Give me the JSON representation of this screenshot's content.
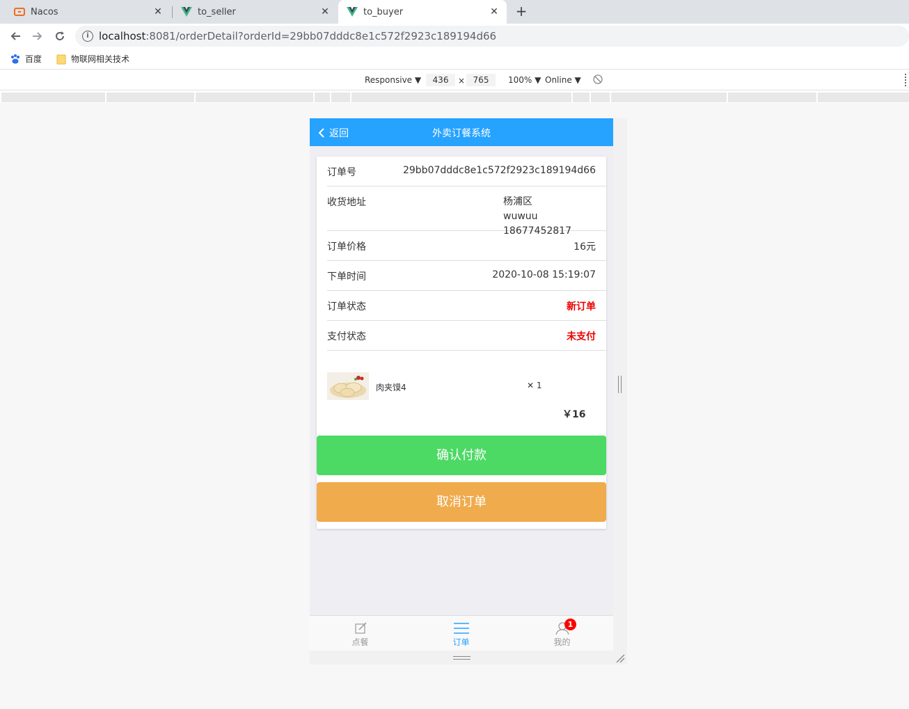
{
  "browser": {
    "tabs": [
      {
        "title": "Nacos",
        "icon": "nacos-icon",
        "close": "✕"
      },
      {
        "title": "to_seller",
        "icon": "vue-icon",
        "close": "✕"
      },
      {
        "title": "to_buyer",
        "icon": "vue-icon",
        "close": "✕"
      }
    ],
    "new_tab": "+",
    "url_host": "localhost",
    "url_rest": ":8081/orderDetail?orderId=29bb07dddc8e1c572f2923c189194d66",
    "bookmarks": [
      {
        "label": "百度",
        "icon": "baidu-paw-icon"
      },
      {
        "label": "物联网相关技术",
        "icon": "folder-icon"
      }
    ]
  },
  "devtools": {
    "device": "Responsive ▼",
    "width": "436",
    "times": "×",
    "height": "765",
    "zoom": "100% ▼",
    "network": "Online ▼"
  },
  "app": {
    "back_label": "返回",
    "title": "外卖订餐系统",
    "order": {
      "id_label": "订单号",
      "id_value": "29bb07dddc8e1c572f2923c189194d66",
      "address_label": "收货地址",
      "address_line1": "杨浦区",
      "address_line2": "wuwuu 18677452817",
      "price_label": "订单价格",
      "price_value": "16元",
      "time_label": "下单时间",
      "time_value": "2020-10-08 15:19:07",
      "status_label": "订单状态",
      "status_value": "新订单",
      "pay_label": "支付状态",
      "pay_value": "未支付",
      "status_color": "#ee0000"
    },
    "item": {
      "name": "肉夹馍4",
      "qty": "✕ 1"
    },
    "total": "￥16",
    "confirm_button": "确认付款",
    "cancel_button": "取消订单",
    "confirm_color": "#4cd964",
    "cancel_color": "#efab4c",
    "accent": "#26a2ff",
    "tabbar": [
      {
        "label": "点餐",
        "icon": "edit-icon"
      },
      {
        "label": "订单",
        "icon": "list-icon"
      },
      {
        "label": "我的",
        "icon": "user-icon"
      }
    ],
    "badge": "1"
  }
}
